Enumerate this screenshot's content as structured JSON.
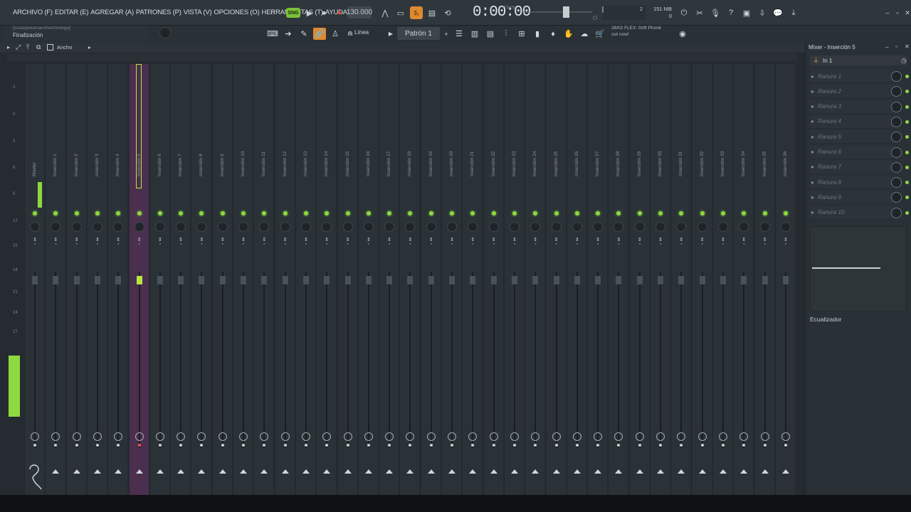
{
  "menu": [
    "ARCHIVO (F)",
    "EDITAR (E)",
    "AGREGAR (A)",
    "PATRONES (P)",
    "VISTA (V)",
    "OPCIONES (O)",
    "HERRAMIENTAS (T)",
    "AYUDA"
  ],
  "transport": {
    "tempo": "130.000",
    "time_main": "0:00:00",
    "time_sub": "M:S:CS"
  },
  "system": {
    "memory": "151 MB",
    "cpu": "0"
  },
  "hint": {
    "user": "[oscarjaviersancheznoriega]",
    "status": "Finalización"
  },
  "toolbar2": {
    "mode": "Línea",
    "pattern": "Patrón 1"
  },
  "news": {
    "line1": "26/02  FLEX: Drift Phonk",
    "line2": "out now!"
  },
  "mixer": {
    "view_label": "Ancho",
    "db_scale": [
      "3",
      "0",
      "3",
      "6",
      "9",
      "12",
      "15",
      "18",
      "21",
      "24",
      "27"
    ],
    "tracks": [
      "Master",
      "Inserción 1",
      "Inserción 2",
      "Inserción 3",
      "Inserción 4",
      "Inserción 5",
      "Inserción 6",
      "Inserción 7",
      "Inserción 8",
      "Inserción 9",
      "Inserción 10",
      "Inserción 11",
      "Inserción 12",
      "Inserción 13",
      "Inserción 14",
      "Inserción 15",
      "Inserción 16",
      "Inserción 17",
      "Inserción 18",
      "Inserción 19",
      "Inserción 20",
      "Inserción 21",
      "Inserción 22",
      "Inserción 23",
      "Inserción 24",
      "Inserción 25",
      "Inserción 26",
      "Inserción 27",
      "Inserción 28",
      "Inserción 29",
      "Inserción 30",
      "Inserción 31",
      "Inserción 32",
      "Inserción 33",
      "Inserción 34",
      "Inserción 35",
      "Inserción 36"
    ],
    "selected": "Inserción 5"
  },
  "insert_panel": {
    "title": "Mixer - Inserción 5",
    "input": "In 1",
    "slots": [
      "Ranura 1",
      "Ranura 2",
      "Ranura 3",
      "Ranura 4",
      "Ranura 5",
      "Ranura 6",
      "Ranura 7",
      "Ranura 8",
      "Ranura 9",
      "Ranura 10"
    ],
    "eq_label": "Ecualizador"
  },
  "colors": {
    "accent_green": "#8dd940",
    "selected_strip": "#4b2f4e",
    "record": "#e0463f"
  }
}
